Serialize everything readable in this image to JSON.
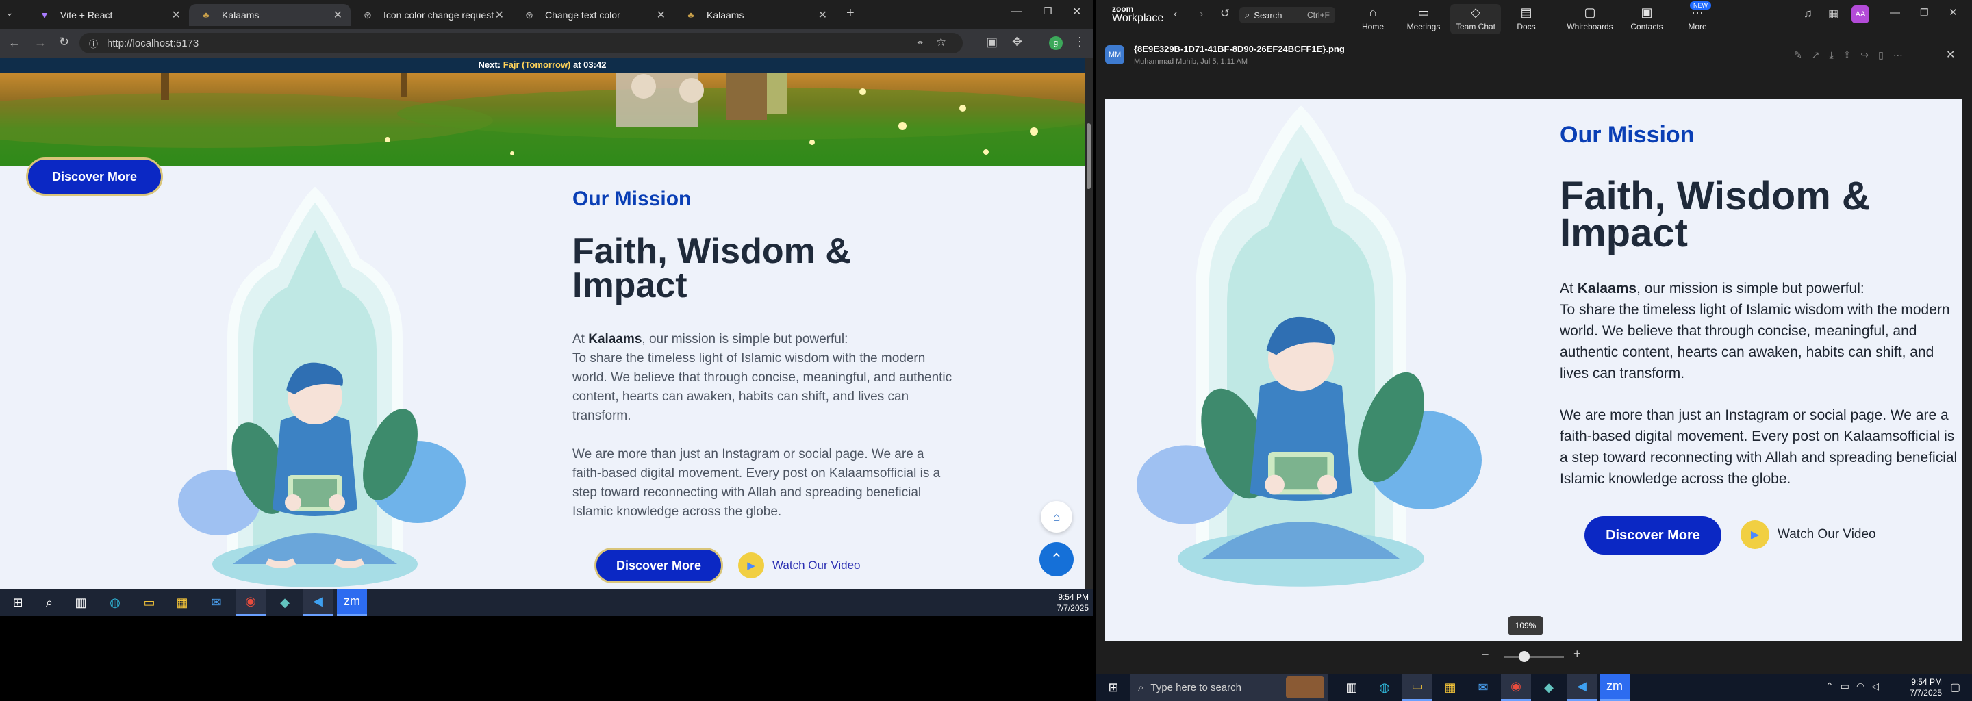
{
  "browser": {
    "tabs": [
      {
        "title": "Vite + React",
        "icon": "vite-icon"
      },
      {
        "title": "Kalaams",
        "icon": "kalaams-icon"
      },
      {
        "title": "Icon color change request",
        "icon": "chatgpt-icon"
      },
      {
        "title": "Change text color",
        "icon": "chatgpt-icon"
      },
      {
        "title": "Kalaams",
        "icon": "kalaams-icon"
      }
    ],
    "url": "http://localhost:5173"
  },
  "site": {
    "prayer_label": "Next:",
    "prayer_name": "Fajr (Tomorrow)",
    "prayer_at": "at 03:42",
    "hero_button": "Discover More",
    "mission_label": "Our Mission",
    "headline": "Faith, Wisdom & Impact",
    "intro_pre": "At ",
    "intro_brand": "Kalaams",
    "intro_post": ", our mission is simple but powerful:",
    "para1": "To share the timeless light of Islamic wisdom with the modern world. We believe that through concise, meaningful, and authentic content, hearts can awaken, habits can shift, and lives can transform.",
    "para2": "We are more than just an Instagram or social page. We are a faith-based digital movement. Every post on Kalaamsofficial is a step toward reconnecting with Allah and spreading beneficial Islamic knowledge across the globe.",
    "discover_button": "Discover More",
    "watch_video": "Watch Our Video"
  },
  "taskbar_left": {
    "time": "9:54 PM",
    "date": "7/7/2025",
    "apps": [
      "start-icon",
      "search-icon",
      "task-view-icon",
      "edge-icon",
      "file-explorer-icon",
      "store-icon",
      "mail-icon",
      "chrome-icon",
      "vscode-alt-icon",
      "vscode-icon",
      "zoom-icon"
    ]
  },
  "zoom": {
    "brand_top": "zoom",
    "brand_bottom": "Workplace",
    "search_label": "Search",
    "search_shortcut": "Ctrl+F",
    "nav": [
      {
        "label": "Home",
        "icon": "home-icon"
      },
      {
        "label": "Meetings",
        "icon": "video-icon"
      },
      {
        "label": "Team Chat",
        "icon": "chat-icon"
      },
      {
        "label": "Docs",
        "icon": "docs-icon"
      },
      {
        "label": "Whiteboards",
        "icon": "whiteboard-icon"
      },
      {
        "label": "Contacts",
        "icon": "contacts-icon"
      },
      {
        "label": "More",
        "icon": "more-icon"
      }
    ],
    "new_badge": "NEW",
    "avatar_initials": "AA",
    "sender_initials": "MM",
    "file_name": "{8E9E329B-1D71-41BF-8D90-26EF24BCFF1E}.png",
    "file_meta": "Muhammad Muhib, Jul 5, 1:11 AM",
    "zoom_level": "109%"
  },
  "taskbar_right": {
    "search_placeholder": "Type here to search",
    "time": "9:54 PM",
    "date": "7/7/2025"
  }
}
